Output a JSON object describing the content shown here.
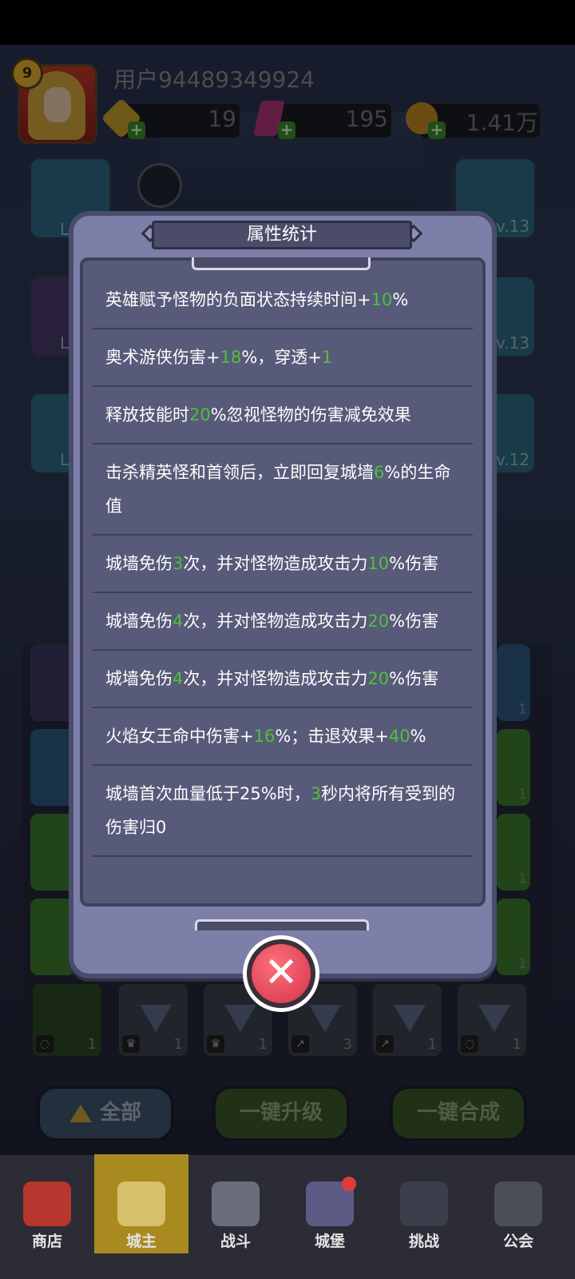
{
  "header": {
    "level": "9",
    "username": "用户94489349924",
    "resources": [
      {
        "name": "gold-coin",
        "value": "19"
      },
      {
        "name": "gem",
        "value": "195"
      },
      {
        "name": "coin",
        "value": "1.41万"
      }
    ]
  },
  "side_tiles": {
    "left": [
      "L",
      "L",
      "L"
    ],
    "right": [
      "v.13",
      "v.13",
      "v.12"
    ]
  },
  "dialog": {
    "title": "属性统计",
    "stats": [
      {
        "parts": [
          {
            "t": "英雄赋予怪物的负面状态持续时间+"
          },
          {
            "t": "10",
            "g": true
          },
          {
            "t": "%"
          }
        ]
      },
      {
        "parts": [
          {
            "t": "奥术游侠伤害+"
          },
          {
            "t": "18",
            "g": true
          },
          {
            "t": "%，穿透+"
          },
          {
            "t": "1",
            "g": true
          }
        ]
      },
      {
        "parts": [
          {
            "t": "释放技能时"
          },
          {
            "t": "20",
            "g": true
          },
          {
            "t": "%忽视怪物的伤害减免效果"
          }
        ]
      },
      {
        "parts": [
          {
            "t": "击杀精英怪和首领后，立即回复城墙"
          },
          {
            "t": "6",
            "g": true
          },
          {
            "t": "%的生命值"
          }
        ]
      },
      {
        "parts": [
          {
            "t": "城墙免伤"
          },
          {
            "t": "3",
            "g": true
          },
          {
            "t": "次，并对怪物造成攻击力"
          },
          {
            "t": "10",
            "g": true
          },
          {
            "t": "%伤害"
          }
        ]
      },
      {
        "parts": [
          {
            "t": "城墙免伤"
          },
          {
            "t": "4",
            "g": true
          },
          {
            "t": "次，并对怪物造成攻击力"
          },
          {
            "t": "20",
            "g": true
          },
          {
            "t": "%伤害"
          }
        ]
      },
      {
        "parts": [
          {
            "t": "城墙免伤"
          },
          {
            "t": "4",
            "g": true
          },
          {
            "t": "次，并对怪物造成攻击力"
          },
          {
            "t": "20",
            "g": true
          },
          {
            "t": "%伤害"
          }
        ]
      },
      {
        "parts": [
          {
            "t": "火焰女王命中伤害+"
          },
          {
            "t": "16",
            "g": true
          },
          {
            "t": "%；击退效果+"
          },
          {
            "t": "40",
            "g": true
          },
          {
            "t": "%"
          }
        ]
      },
      {
        "parts": [
          {
            "t": "城墙首次血量低于25%时，"
          },
          {
            "t": "3",
            "g": true
          },
          {
            "t": "秒内将所有受到的伤害归0"
          }
        ]
      }
    ]
  },
  "slots": [
    {
      "count": "1",
      "icon": "ring"
    },
    {
      "count": "1",
      "icon": "crown"
    },
    {
      "count": "1",
      "icon": "crown"
    },
    {
      "count": "3",
      "icon": "boot"
    },
    {
      "count": "1",
      "icon": "boot"
    },
    {
      "count": "1",
      "icon": "ring"
    }
  ],
  "side_counts": [
    "1",
    "1",
    "1",
    "1",
    "1"
  ],
  "actions": {
    "all": "全部",
    "upgrade": "一键升级",
    "merge": "一键合成"
  },
  "nav": [
    {
      "label": "商店",
      "active": false
    },
    {
      "label": "城主",
      "active": true
    },
    {
      "label": "战斗",
      "active": false
    },
    {
      "label": "城堡",
      "active": false
    },
    {
      "label": "挑战",
      "active": false
    },
    {
      "label": "公会",
      "active": false
    }
  ],
  "colors": {
    "highlight": "#4ec03c",
    "dialog_bg": "#7c7fa7",
    "close_red": "#d3334a",
    "nav_active": "#a88a20"
  }
}
